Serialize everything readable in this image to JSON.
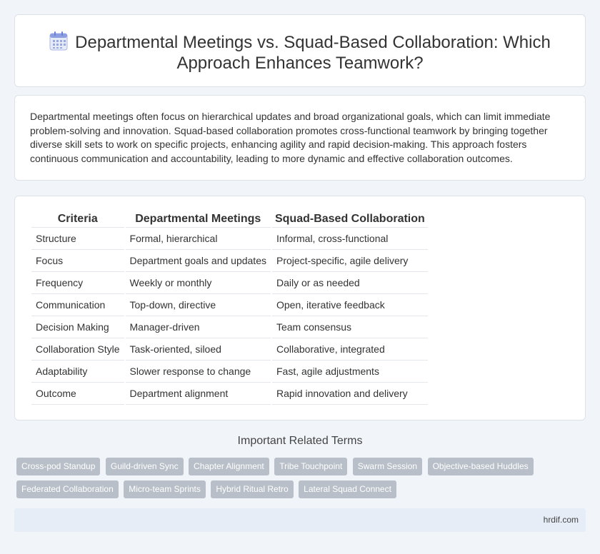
{
  "header": {
    "title": "Departmental Meetings vs. Squad-Based Collaboration: Which Approach Enhances Teamwork?",
    "icon": "calendar-icon"
  },
  "intro": {
    "text": "Departmental meetings often focus on hierarchical updates and broad organizational goals, which can limit immediate problem-solving and innovation. Squad-based collaboration promotes cross-functional teamwork by bringing together diverse skill sets to work on specific projects, enhancing agility and rapid decision-making. This approach fosters continuous communication and accountability, leading to more dynamic and effective collaboration outcomes."
  },
  "table": {
    "headers": [
      "Criteria",
      "Departmental Meetings",
      "Squad-Based Collaboration"
    ],
    "rows": [
      [
        "Structure",
        "Formal, hierarchical",
        "Informal, cross-functional"
      ],
      [
        "Focus",
        "Department goals and updates",
        "Project-specific, agile delivery"
      ],
      [
        "Frequency",
        "Weekly or monthly",
        "Daily or as needed"
      ],
      [
        "Communication",
        "Top-down, directive",
        "Open, iterative feedback"
      ],
      [
        "Decision Making",
        "Manager-driven",
        "Team consensus"
      ],
      [
        "Collaboration Style",
        "Task-oriented, siloed",
        "Collaborative, integrated"
      ],
      [
        "Adaptability",
        "Slower response to change",
        "Fast, agile adjustments"
      ],
      [
        "Outcome",
        "Department alignment",
        "Rapid innovation and delivery"
      ]
    ]
  },
  "related": {
    "heading": "Important Related Terms",
    "tags": [
      "Cross-pod Standup",
      "Guild-driven Sync",
      "Chapter Alignment",
      "Tribe Touchpoint",
      "Swarm Session",
      "Objective-based Huddles",
      "Federated Collaboration",
      "Micro-team Sprints",
      "Hybrid Ritual Retro",
      "Lateral Squad Connect"
    ]
  },
  "footer": {
    "site": "hrdif.com"
  },
  "colors": {
    "background": "#f1f4f9",
    "tag": "#b8bfc8",
    "footer": "#e7edf7",
    "icon_accent": "#6a7fd6"
  }
}
